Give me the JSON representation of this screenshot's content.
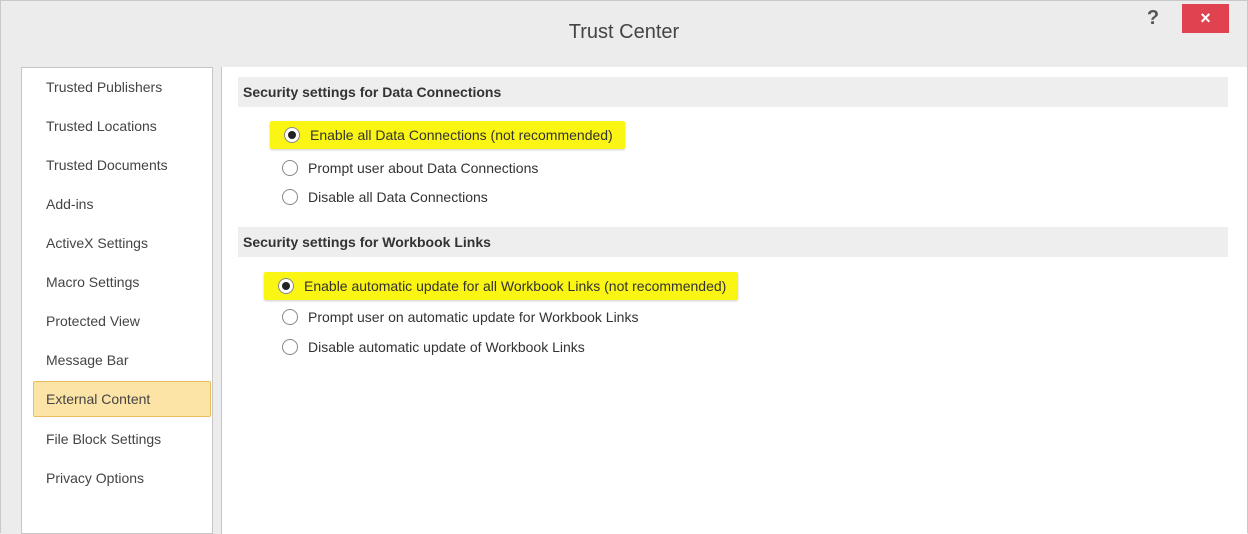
{
  "window": {
    "title": "Trust Center"
  },
  "titlebar": {
    "help_label": "?",
    "close_label": "×"
  },
  "nav": {
    "items": [
      {
        "label": "Trusted Publishers"
      },
      {
        "label": "Trusted Locations"
      },
      {
        "label": "Trusted Documents"
      },
      {
        "label": "Add-ins"
      },
      {
        "label": "ActiveX Settings"
      },
      {
        "label": "Macro Settings"
      },
      {
        "label": "Protected View"
      },
      {
        "label": "Message Bar"
      },
      {
        "label": "External Content"
      },
      {
        "label": "File Block Settings"
      },
      {
        "label": "Privacy Options"
      }
    ],
    "selected": "External Content"
  },
  "sections": [
    {
      "title": "Security settings for Data Connections",
      "options": [
        {
          "label": "Enable all Data Connections (not recommended)",
          "checked": true,
          "highlighted": true
        },
        {
          "label": "Prompt user about Data Connections",
          "checked": false,
          "highlighted": false
        },
        {
          "label": "Disable all Data Connections",
          "checked": false,
          "highlighted": false
        }
      ]
    },
    {
      "title": "Security settings for Workbook Links",
      "options": [
        {
          "label": "Enable automatic update for all Workbook Links (not recommended)",
          "checked": true,
          "highlighted": true
        },
        {
          "label": "Prompt user on automatic update for Workbook Links",
          "checked": false,
          "highlighted": false
        },
        {
          "label": "Disable automatic update of Workbook Links",
          "checked": false,
          "highlighted": false
        }
      ]
    }
  ],
  "colors": {
    "highlight": "#fbf513",
    "selected_nav": "#fce4a6",
    "close": "#e0424f"
  }
}
